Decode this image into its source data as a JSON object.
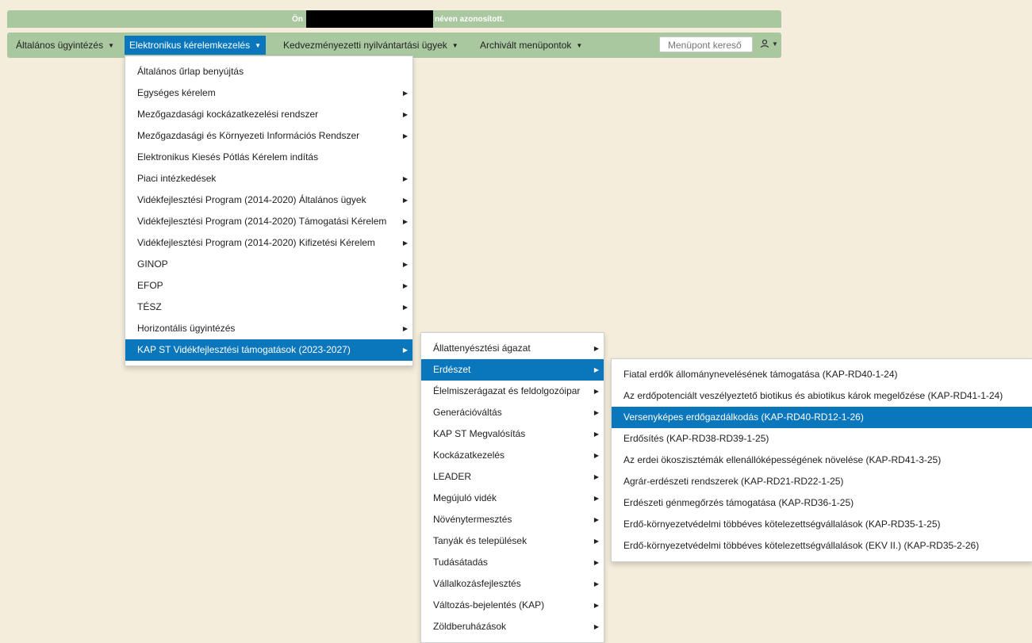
{
  "topbar": {
    "prefix": "Ön",
    "suffix": "néven azonosított."
  },
  "nav": {
    "items": [
      {
        "label": "Általános ügyintézés"
      },
      {
        "label": "Elektronikus kérelemkezelés"
      },
      {
        "label": "Kedvezményezetti nyilvántartási ügyek"
      },
      {
        "label": "Archivált menüpontok"
      }
    ],
    "search_placeholder": "Menüpont kereső"
  },
  "menu1": [
    {
      "label": "Általános űrlap benyújtás"
    },
    {
      "label": "Egységes kérelem"
    },
    {
      "label": "Mezőgazdasági kockázatkezelési rendszer"
    },
    {
      "label": "Mezőgazdasági és Környezeti Információs Rendszer"
    },
    {
      "label": "Elektronikus Kiesés Pótlás Kérelem indítás"
    },
    {
      "label": "Piaci intézkedések"
    },
    {
      "label": "Vidékfejlesztési Program (2014-2020) Általános ügyek"
    },
    {
      "label": "Vidékfejlesztési Program (2014-2020) Támogatási Kérelem"
    },
    {
      "label": "Vidékfejlesztési Program (2014-2020) Kifizetési Kérelem"
    },
    {
      "label": "GINOP"
    },
    {
      "label": "EFOP"
    },
    {
      "label": "TÉSZ"
    },
    {
      "label": "Horizontális ügyintézés"
    },
    {
      "label": "KAP ST Vidékfejlesztési támogatások (2023-2027)"
    }
  ],
  "menu2": [
    {
      "label": "Állattenyésztési ágazat"
    },
    {
      "label": "Erdészet"
    },
    {
      "label": "Élelmiszerágazat és feldolgozóipar"
    },
    {
      "label": "Generációváltás"
    },
    {
      "label": "KAP ST Megvalósítás"
    },
    {
      "label": "Kockázatkezelés"
    },
    {
      "label": "LEADER"
    },
    {
      "label": "Megújuló vidék"
    },
    {
      "label": "Növénytermesztés"
    },
    {
      "label": "Tanyák és települések"
    },
    {
      "label": "Tudásátadás"
    },
    {
      "label": "Vállalkozásfejlesztés"
    },
    {
      "label": "Változás-bejelentés (KAP)"
    },
    {
      "label": "Zöldberuházások"
    }
  ],
  "menu3": [
    {
      "label": "Fiatal erdők állománynevelésének támogatása (KAP-RD40-1-24)"
    },
    {
      "label": "Az erdőpotenciált veszélyeztető biotikus és abiotikus károk megelőzése (KAP-RD41-1-24)"
    },
    {
      "label": "Versenyképes erdőgazdálkodás (KAP-RD40-RD12-1-26)"
    },
    {
      "label": "Erdősítés (KAP-RD38-RD39-1-25)"
    },
    {
      "label": "Az erdei ökoszisztémák ellenállóképességének növelése (KAP-RD41-3-25)"
    },
    {
      "label": "Agrár-erdészeti rendszerek (KAP-RD21-RD22-1-25)"
    },
    {
      "label": "Erdészeti génmegőrzés támogatása (KAP-RD36-1-25)"
    },
    {
      "label": "Erdő-környezetvédelmi többéves kötelezettségvállalások (KAP-RD35-1-25)"
    },
    {
      "label": "Erdő-környezetvédelmi többéves kötelezettségvállalások (EKV II.) (KAP-RD35-2-26)"
    }
  ]
}
